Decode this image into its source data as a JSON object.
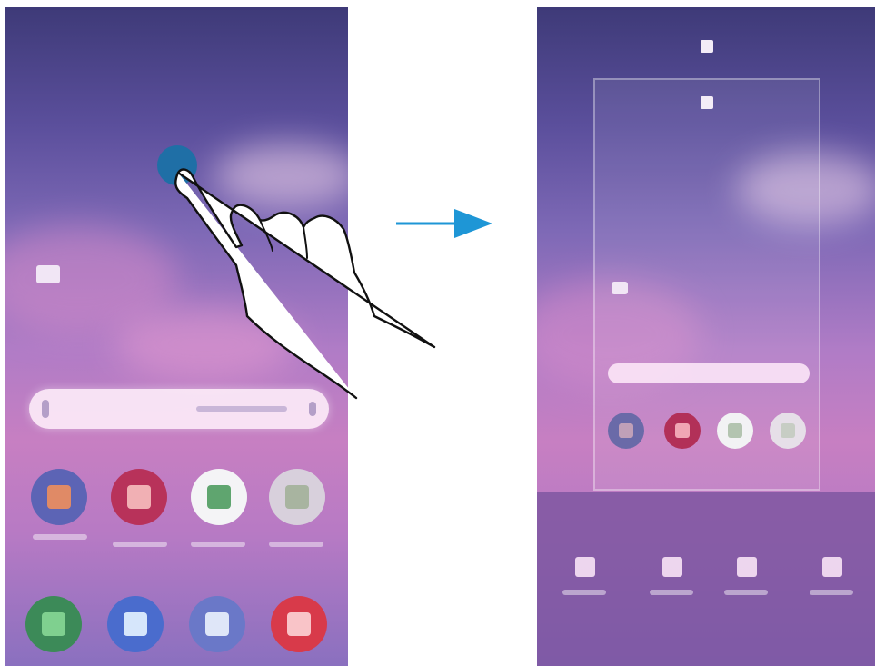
{
  "figure": {
    "description_mode": "illustration",
    "transition_arrow": "arrow-right-icon",
    "colors": {
      "arrow": "#1e96d6",
      "touch_point": "#1f6fa6",
      "hand_fill": "#ffffff",
      "hand_stroke": "#111111"
    }
  },
  "left_screen": {
    "gesture": "tap-and-hold",
    "app_rows": [
      {
        "icons": [
          "gallery-icon",
          "store-icon",
          "play-store-icon",
          "google-folder-icon"
        ]
      },
      {
        "icons": [
          "phone-icon",
          "messages-icon",
          "internet-icon",
          "camera-icon"
        ]
      }
    ]
  },
  "right_screen": {
    "mode": "home-screen-edit",
    "edit_options": [
      "wallpapers-icon",
      "themes-icon",
      "widgets-icon",
      "settings-icon"
    ]
  }
}
